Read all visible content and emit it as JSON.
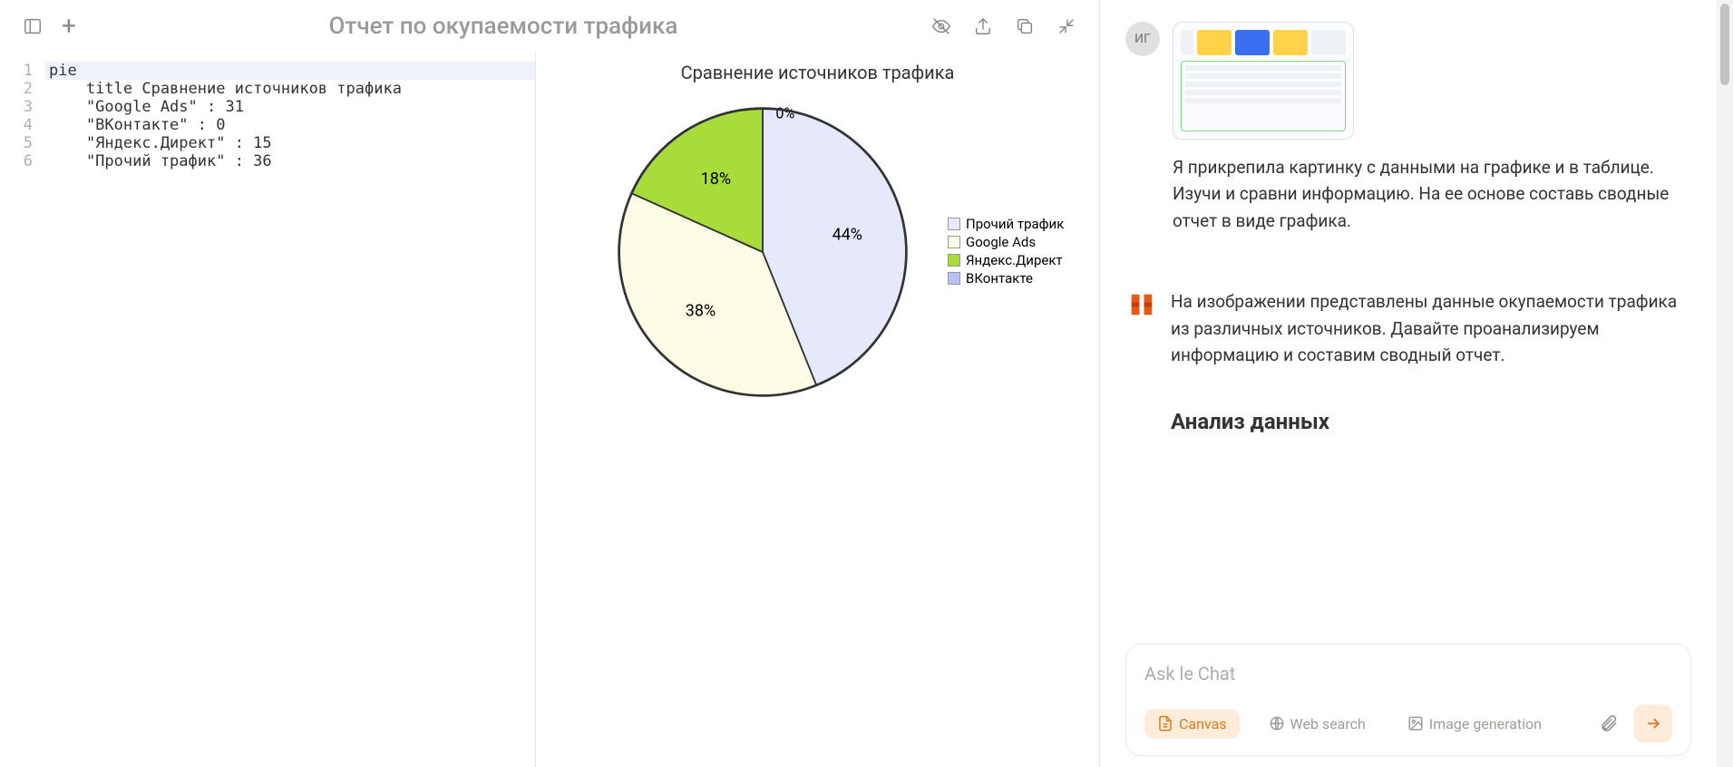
{
  "header": {
    "title": "Отчет по окупаемости трафика"
  },
  "code": {
    "lines": [
      "pie",
      "    title Сравнение источников трафика",
      "    \"Google Ads\" : 31",
      "    \"ВКонтакте\" : 0",
      "    \"Яндекс.Директ\" : 15",
      "    \"Прочий трафик\" : 36"
    ]
  },
  "chart_data": {
    "type": "pie",
    "title": "Сравнение источников трафика",
    "series": [
      {
        "name": "Прочий трафик",
        "value": 36,
        "pct": "44%",
        "color": "#e6e9fb"
      },
      {
        "name": "Google Ads",
        "value": 31,
        "pct": "38%",
        "color": "#fcfce6"
      },
      {
        "name": "Яндекс.Директ",
        "value": 15,
        "pct": "18%",
        "color": "#a8dc3a"
      },
      {
        "name": "ВКонтакте",
        "value": 0,
        "pct": "0%",
        "color": "#b9c0f5"
      }
    ]
  },
  "chat": {
    "user_avatar": "ИГ",
    "user_message": "Я прикрепила картинку с данными на графике и в таблице. Изучи и сравни информацию. На ее основе составь сводные отчет в виде графика.",
    "assistant_message": "На изображении представлены данные окупаемости трафика из различных источников. Давайте проанализируем информацию и составим сводный отчет.",
    "section_heading": "Анализ данных"
  },
  "input": {
    "placeholder": "Ask le Chat",
    "tools": {
      "canvas": "Canvas",
      "web_search": "Web search",
      "image_gen": "Image generation"
    }
  }
}
